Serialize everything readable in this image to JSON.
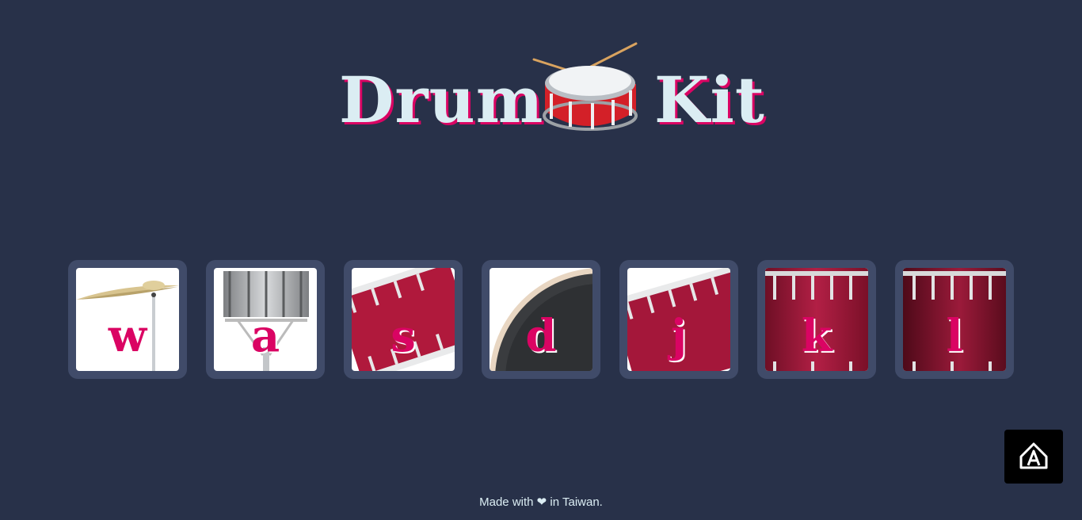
{
  "header": {
    "word_left": "Drum",
    "word_right": "Kit",
    "logo_icon": "snare-drum-icon"
  },
  "keys": [
    {
      "letter": "w",
      "instrument": "cymbal"
    },
    {
      "letter": "a",
      "instrument": "snare-silver"
    },
    {
      "letter": "s",
      "instrument": "tom-red"
    },
    {
      "letter": "d",
      "instrument": "bass-drum"
    },
    {
      "letter": "j",
      "instrument": "tom-red"
    },
    {
      "letter": "k",
      "instrument": "floor-tom"
    },
    {
      "letter": "l",
      "instrument": "floor-tom-dark"
    }
  ],
  "footer": {
    "before": "Made with",
    "heart": "❤",
    "after": "in Taiwan."
  },
  "accessibility": {
    "icon": "accessibility-icon"
  },
  "colors": {
    "background": "#283149",
    "key_frame": "#404b69",
    "accent": "#da0463",
    "text": "#dbedf3"
  }
}
